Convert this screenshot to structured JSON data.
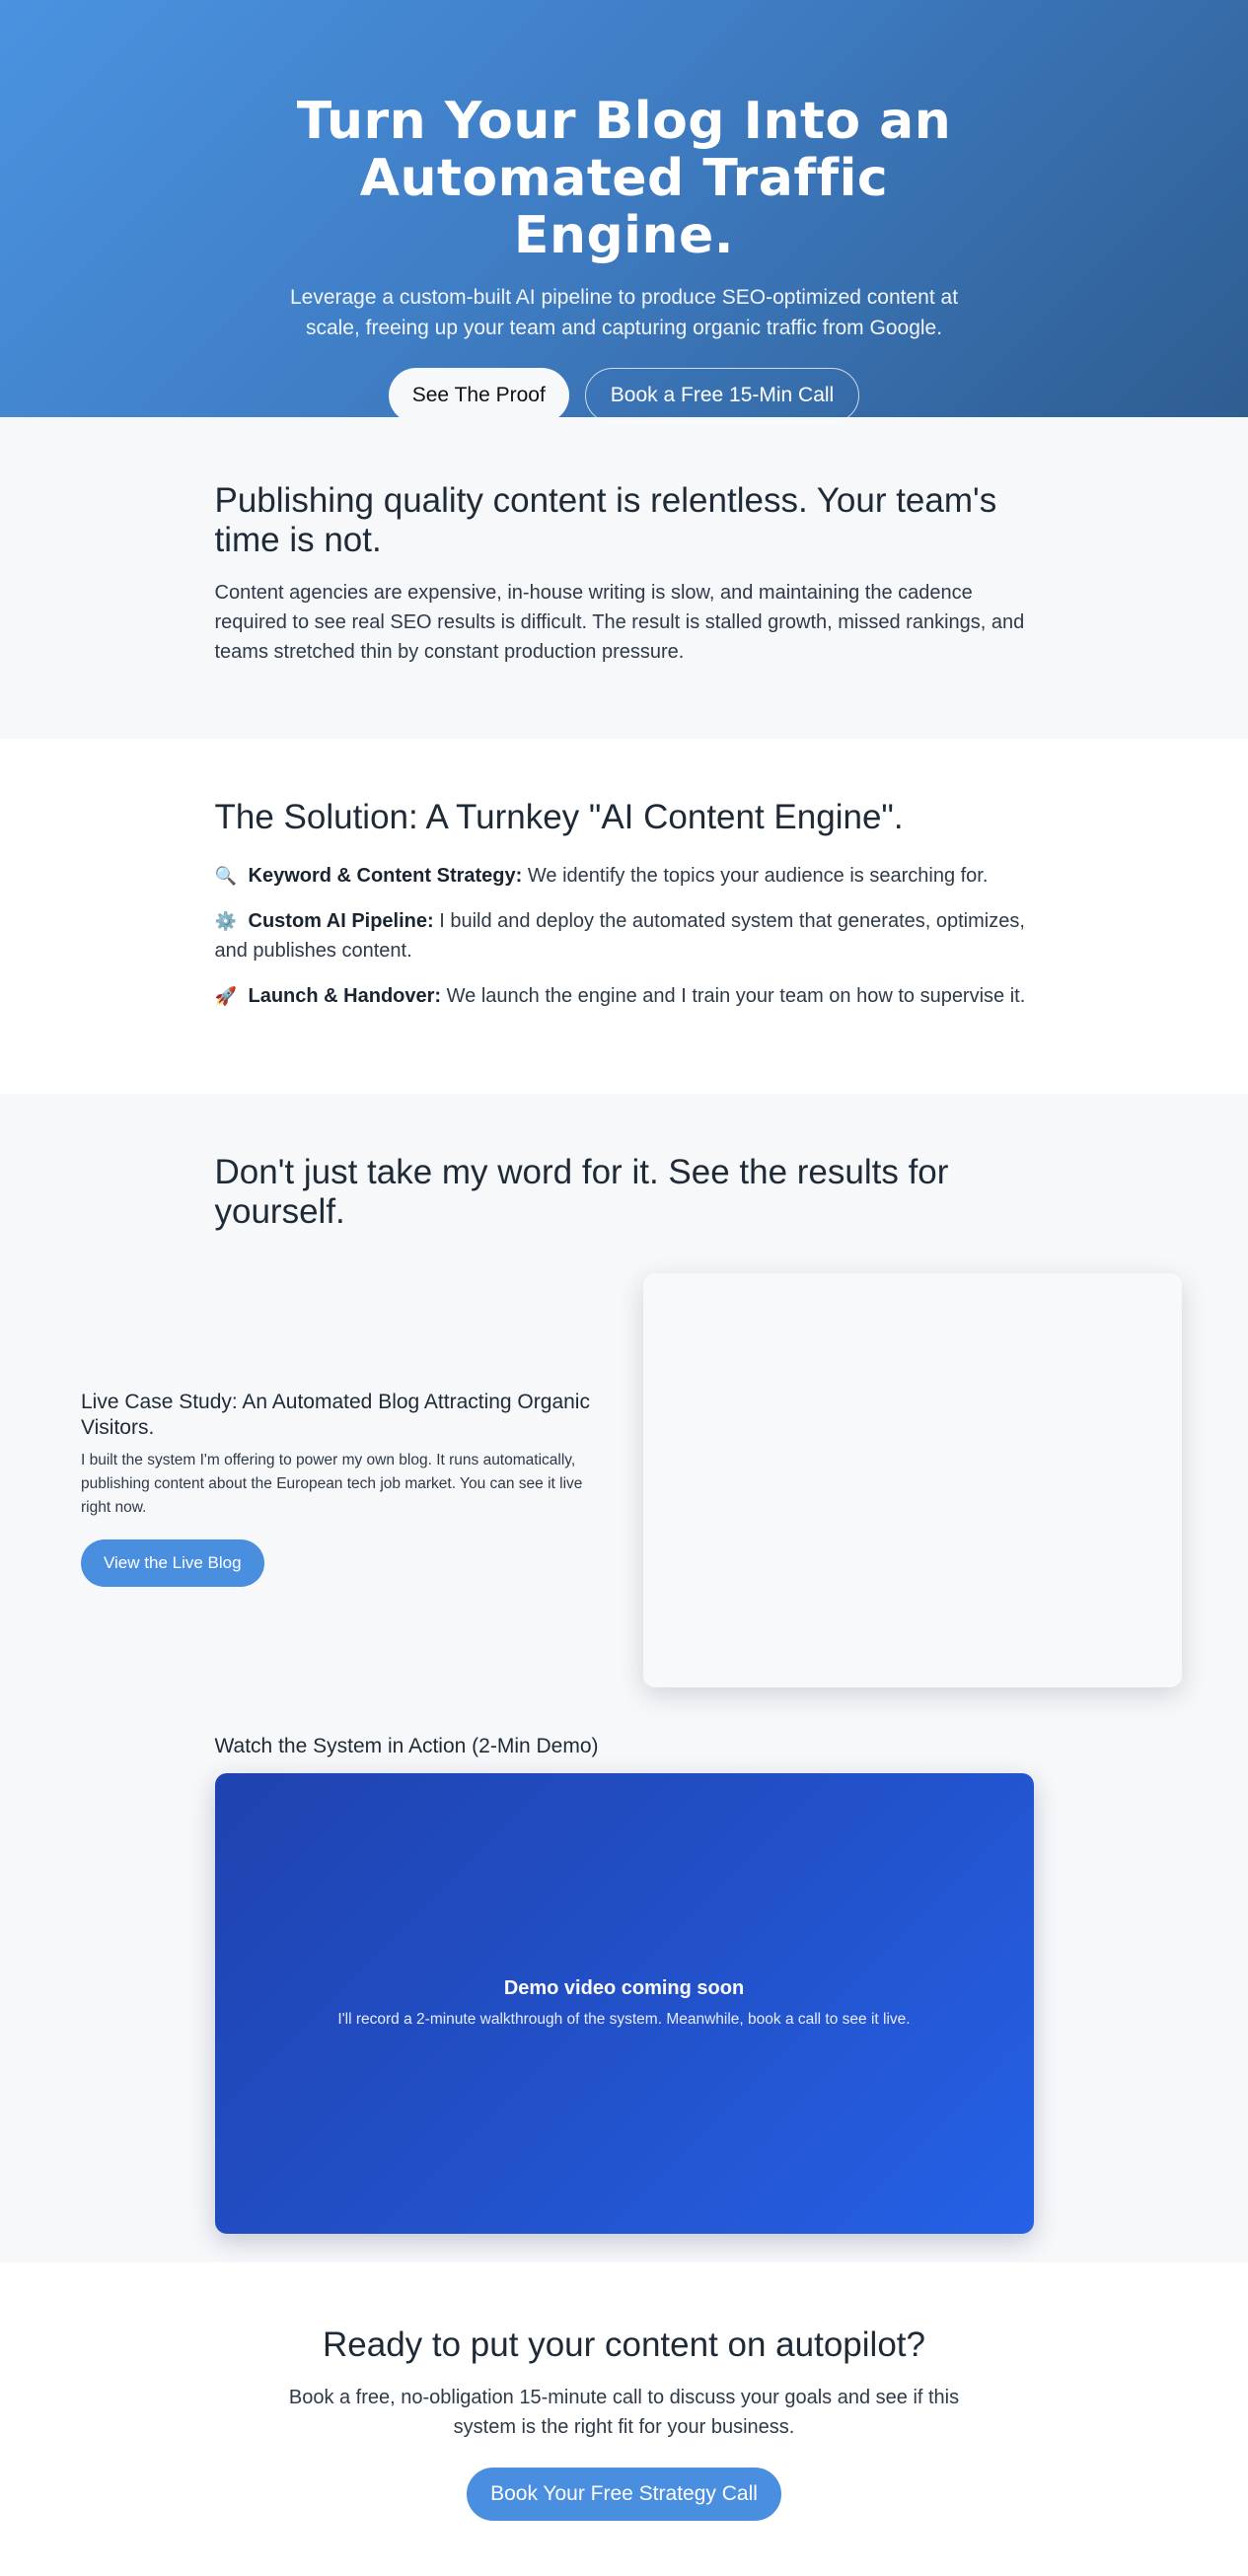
{
  "hero": {
    "title_line1": "Turn Your Blog Into an",
    "title_line2": "Automated Traffic Engine.",
    "subtitle": "Leverage a custom-built AI pipeline to produce SEO-optimized content at scale, freeing up your team and capturing organic traffic from Google.",
    "primary_button": "See The Proof",
    "secondary_button": "Book a Free 15-Min Call"
  },
  "problem": {
    "heading": "Publishing quality content is relentless. Your team's time is not.",
    "body": "Content agencies are expensive, in-house writing is slow, and maintaining the cadence required to see real SEO results is difficult. The result is stalled growth, missed rankings, and teams stretched thin by constant production pressure."
  },
  "solution": {
    "heading": "The Solution: A Turnkey \"AI Content Engine\".",
    "items": [
      {
        "icon": "magnifier-icon",
        "glyph": "🔍",
        "title": "Keyword & Content Strategy:",
        "text": " We identify the topics your audience is searching for."
      },
      {
        "icon": "gear-icon",
        "glyph": "⚙️",
        "title": "Custom AI Pipeline:",
        "text": " I build and deploy the automated system that generates, optimizes, and publishes content."
      },
      {
        "icon": "rocket-icon",
        "glyph": "🚀",
        "title": "Launch & Handover:",
        "text": " We launch the engine and I train your team on how to supervise it."
      }
    ]
  },
  "proof": {
    "heading": "Don't just take my word for it. See the results for yourself.",
    "case_title": "Live Case Study: An Automated Blog Attracting Organic Visitors.",
    "case_desc": "I built the system I'm offering to power my own blog. It runs automatically, publishing content about the European tech job market. You can see it live right now.",
    "case_button": "View the Live Blog",
    "demo_title": "Watch the System in Action (2-Min Demo)",
    "demo_heading": "Demo video coming soon",
    "demo_text": "I'll record a 2-minute walkthrough of the system. Meanwhile, book a call to see it live."
  },
  "cta": {
    "heading": "Ready to put your content on autopilot?",
    "subtitle": "Book a free, no-obligation 15-minute call to discuss your goals and see if this system is the right fit for your business.",
    "button": "Book Your Free Strategy Call"
  },
  "colors": {
    "hero_gradient_start": "#4a93e0",
    "hero_gradient_end": "#2e5d91",
    "accent_blue": "#4a8ee0",
    "demo_gradient_start": "#1f43b0",
    "demo_gradient_end": "#2561e6",
    "section_alt_bg": "#f7f8fa"
  }
}
